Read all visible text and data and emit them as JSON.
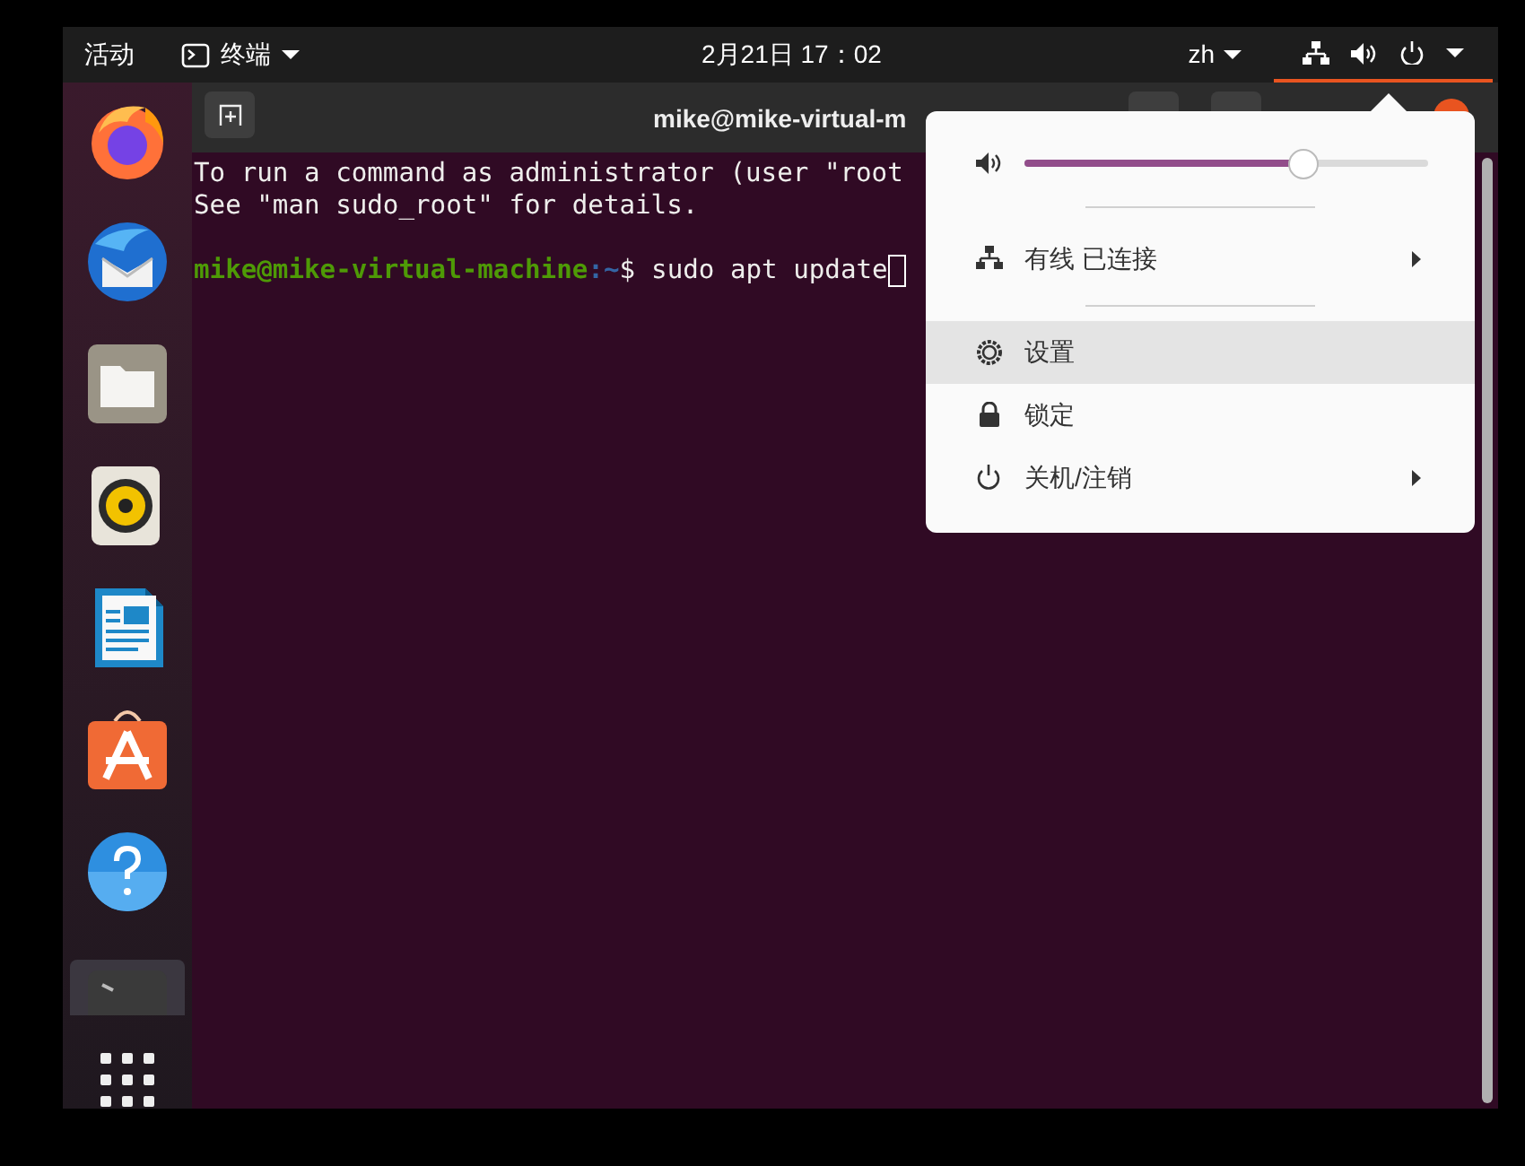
{
  "top_bar": {
    "activities": "活动",
    "app_menu": {
      "label": "终端"
    },
    "clock": "2月21日 17：02",
    "input_method": "zh",
    "system_menu_open": true
  },
  "dock": {
    "apps": [
      {
        "kind": "firefox"
      },
      {
        "kind": "thunderbird"
      },
      {
        "kind": "files"
      },
      {
        "kind": "rhythmbox"
      },
      {
        "kind": "writer"
      },
      {
        "kind": "software"
      },
      {
        "kind": "help"
      },
      {
        "kind": "terminal",
        "selected": true
      }
    ]
  },
  "terminal": {
    "title": "mike@mike-virtual-m",
    "lines": [
      "To run a command as administrator (user \"root",
      "See \"man sudo_root\" for details."
    ],
    "prompt": {
      "user_host": "mike@mike-virtual-machine",
      "path": ":~",
      "symbol": "$",
      "command": "sudo apt update"
    }
  },
  "system_menu": {
    "volume": {
      "level": 0.69
    },
    "items": [
      {
        "kind": "network",
        "label": "有线 已连接",
        "has_submenu": true,
        "selected": false,
        "separator_after": true
      },
      {
        "kind": "settings",
        "label": "设置",
        "has_submenu": false,
        "selected": true,
        "separator_after": false
      },
      {
        "kind": "lock",
        "label": "锁定",
        "has_submenu": false,
        "selected": false,
        "separator_after": false
      },
      {
        "kind": "power",
        "label": "关机/注销",
        "has_submenu": true,
        "selected": false,
        "separator_after": false
      }
    ]
  }
}
